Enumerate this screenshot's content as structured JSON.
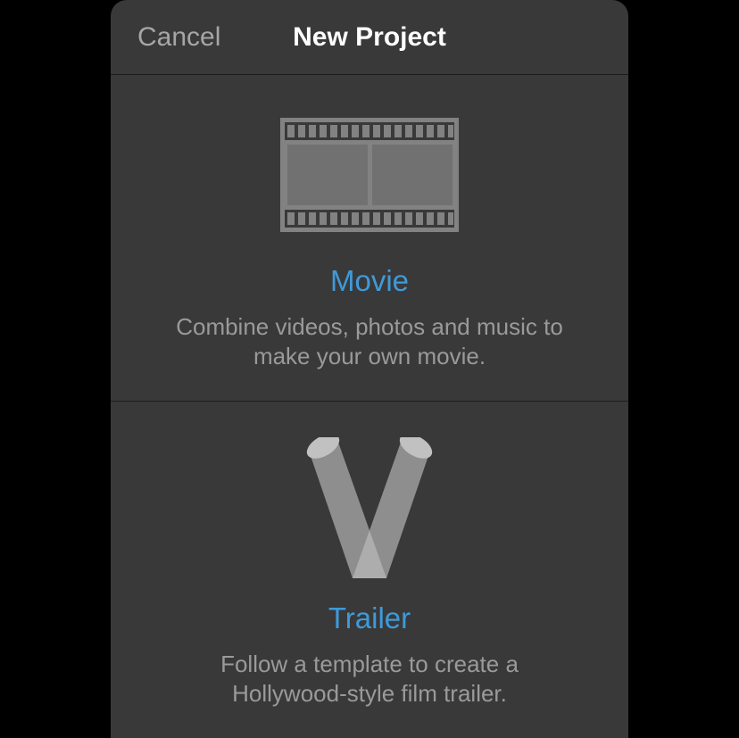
{
  "header": {
    "cancel_label": "Cancel",
    "title": "New Project"
  },
  "options": {
    "movie": {
      "title": "Movie",
      "description": "Combine videos, photos and music to make your own movie."
    },
    "trailer": {
      "title": "Trailer",
      "description": "Follow a template to create a Hollywood-style film trailer."
    }
  },
  "colors": {
    "accent": "#3f9ad8",
    "background": "#393939",
    "secondary_text": "#9a9a9a"
  }
}
